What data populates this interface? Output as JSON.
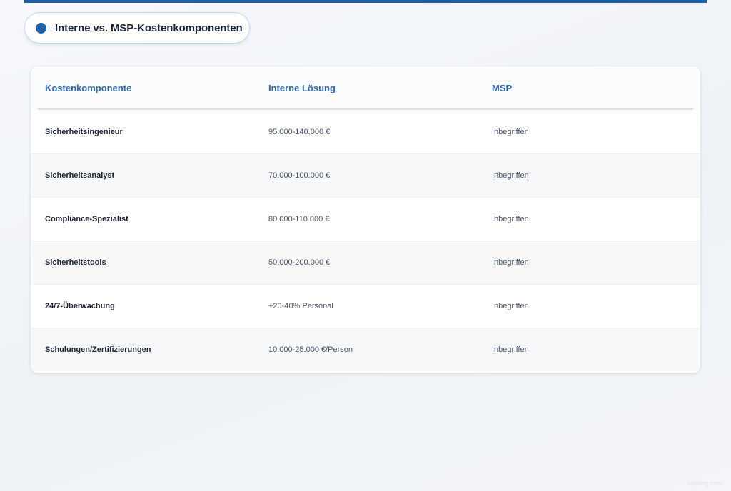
{
  "header": {
    "title": "Interne vs. MSP-Kostenkomponenten",
    "accent_color": "#1f5fa6"
  },
  "table": {
    "columns": [
      "Kostenkomponente",
      "Interne Lösung",
      "MSP"
    ],
    "rows": [
      {
        "component": "Sicherheitsingenieur",
        "internal": "95.000-140.000 €",
        "msp": "Inbegriffen"
      },
      {
        "component": "Sicherheitsanalyst",
        "internal": "70.000-100.000 €",
        "msp": "Inbegriffen"
      },
      {
        "component": "Compliance-Spezialist",
        "internal": "80.000-110.000 €",
        "msp": "Inbegriffen"
      },
      {
        "component": "Sicherheitstools",
        "internal": "50.000-200.000 €",
        "msp": "Inbegriffen"
      },
      {
        "component": "24/7-Überwachung",
        "internal": "+20-40% Personal",
        "msp": "Inbegriffen"
      },
      {
        "component": "Schulungen/Zertifizierungen",
        "internal": "10.000-25.000 €/Person",
        "msp": "Inbegriffen"
      }
    ]
  },
  "footer": {
    "watermark": "skywag.com"
  }
}
